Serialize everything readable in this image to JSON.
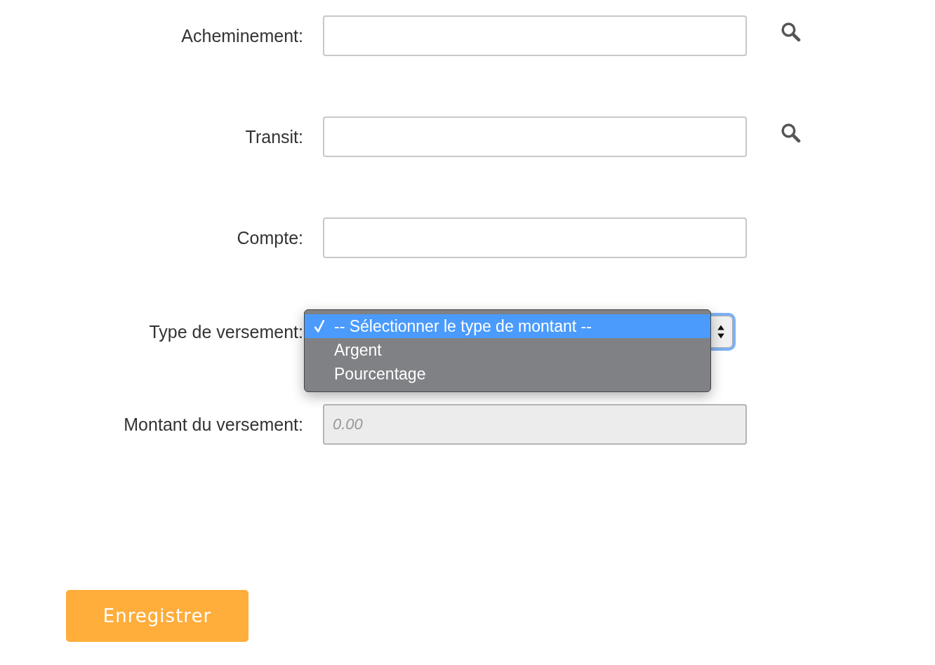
{
  "fields": [
    {
      "label": "Acheminement:",
      "kind": "search",
      "disabled": false
    },
    {
      "label": "Transit:",
      "kind": "search",
      "disabled": false
    },
    {
      "label": "Compte:",
      "kind": "text",
      "disabled": false
    },
    {
      "label": "Type de versement:",
      "kind": "select",
      "expanded": true,
      "options": [
        {
          "label": "-- Sélectionner le type de montant --",
          "selected": true
        },
        {
          "label": "Argent",
          "selected": false
        },
        {
          "label": "Pourcentage",
          "selected": false
        }
      ]
    },
    {
      "label": "Montant du versement:",
      "kind": "text",
      "placeholder": "0.00",
      "disabled": true
    }
  ],
  "buttons": [
    {
      "label": "Enregistrer"
    }
  ]
}
